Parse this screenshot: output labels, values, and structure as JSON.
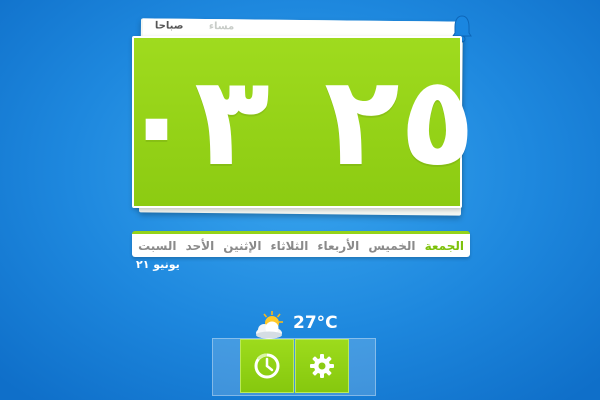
{
  "clock": {
    "tabs": {
      "active": "صباحا",
      "inactive": "مساء"
    },
    "hours": "٢٥",
    "minutes": "٠٣"
  },
  "days": [
    {
      "label": "السبت",
      "active": false
    },
    {
      "label": "الأحد",
      "active": false
    },
    {
      "label": "الإثنين",
      "active": false
    },
    {
      "label": "الثلاثاء",
      "active": false
    },
    {
      "label": "الأربعاء",
      "active": false
    },
    {
      "label": "الخميس",
      "active": false
    },
    {
      "label": "الجمعة",
      "active": true
    }
  ],
  "date_label": "يونيو ٢١",
  "weather": {
    "temperature": "27°C",
    "icon": "partly-cloudy-icon"
  },
  "toolbar": {
    "stats_icon": "stopwatch-icon",
    "settings_icon": "gear-icon"
  },
  "colors": {
    "accent_green": "#8ccb12",
    "background_blue": "#1e88de",
    "active_day": "#7dc10a"
  }
}
